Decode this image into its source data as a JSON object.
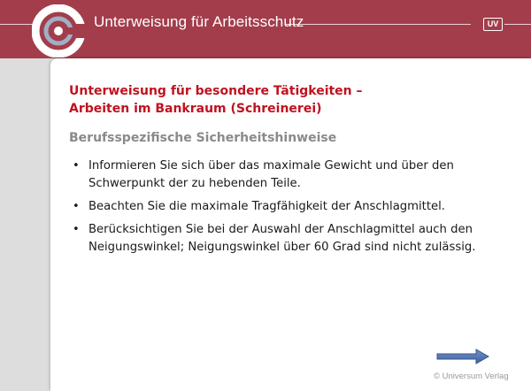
{
  "header": {
    "title": "Unterweisung für Arbeitsschutz",
    "badge": "UV",
    "accent_color": "#a33d4b"
  },
  "content": {
    "title_line1": "Unterweisung für besondere Tätigkeiten –",
    "title_line2": "Arbeiten im Bankraum (Schreinerei)",
    "subtitle": "Berufsspezifische Sicherheitshinweise",
    "bullets": [
      "Informieren Sie sich über das maximale Gewicht und über den Schwerpunkt der zu hebenden Teile.",
      "Beachten Sie die maximale Tragfähigkeit der Anschlagmittel.",
      "Berücksichtigen Sie bei der Auswahl der Anschlagmittel auch den Neigungswinkel; Neigungswinkel über 60 Grad sind nicht zulässig."
    ],
    "bullet_char": "•"
  },
  "navigation": {
    "next_icon": "arrow-right-icon"
  },
  "footer": {
    "copyright": "© Universum Verlag"
  }
}
